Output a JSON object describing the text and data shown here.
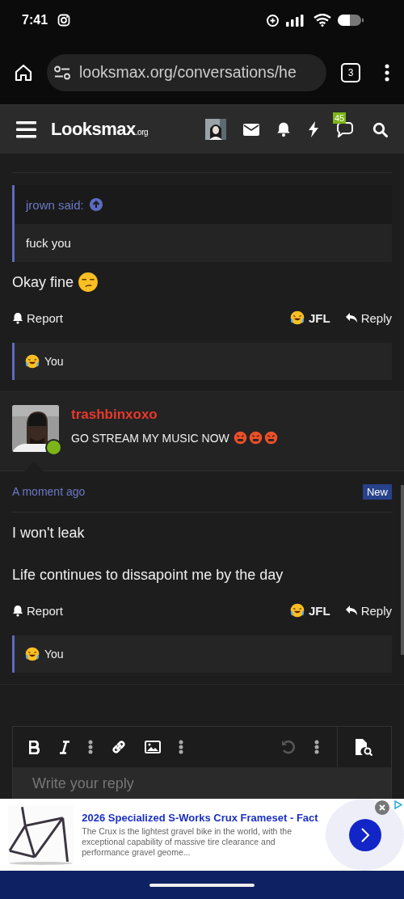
{
  "status_bar": {
    "time": "7:41"
  },
  "browser": {
    "url": "looksmax.org/conversations/he",
    "tab_count": "3"
  },
  "site_header": {
    "logo": "Looksmax",
    "logo_suffix": ".org",
    "notification_count": "45"
  },
  "messages": [
    {
      "quote": {
        "author": "jrown said:",
        "text": "fuck you"
      },
      "lines": [
        {
          "text": "Okay fine",
          "emojis": [
            {
              "kind": "unamused"
            }
          ]
        }
      ],
      "actions": {
        "report": "Report",
        "reaction": "JFL",
        "reply": "Reply"
      },
      "reactions": "You"
    },
    {
      "author": "trashbinxoxo",
      "status": "GO STREAM MY MUSIC NOW",
      "status_emojis": [
        {
          "kind": "cursing"
        },
        {
          "kind": "cursing"
        },
        {
          "kind": "cursing"
        }
      ],
      "online": true,
      "time": "A moment ago",
      "badge": "New",
      "lines": [
        {
          "text": "I won't leak"
        },
        {
          "text": "Life continues to dissapoint me by the day"
        }
      ],
      "actions": {
        "report": "Report",
        "reaction": "JFL",
        "reply": "Reply"
      },
      "reactions": "You"
    }
  ],
  "editor": {
    "placeholder": "Write your reply",
    "undo_disabled": true
  },
  "ad": {
    "title": "2026 Specialized S-Works Crux Frameset - Fact",
    "text": "The Crux is the lightest gravel bike in the world, with the exceptional capability of massive tire clearance and performance gravel geome..."
  }
}
